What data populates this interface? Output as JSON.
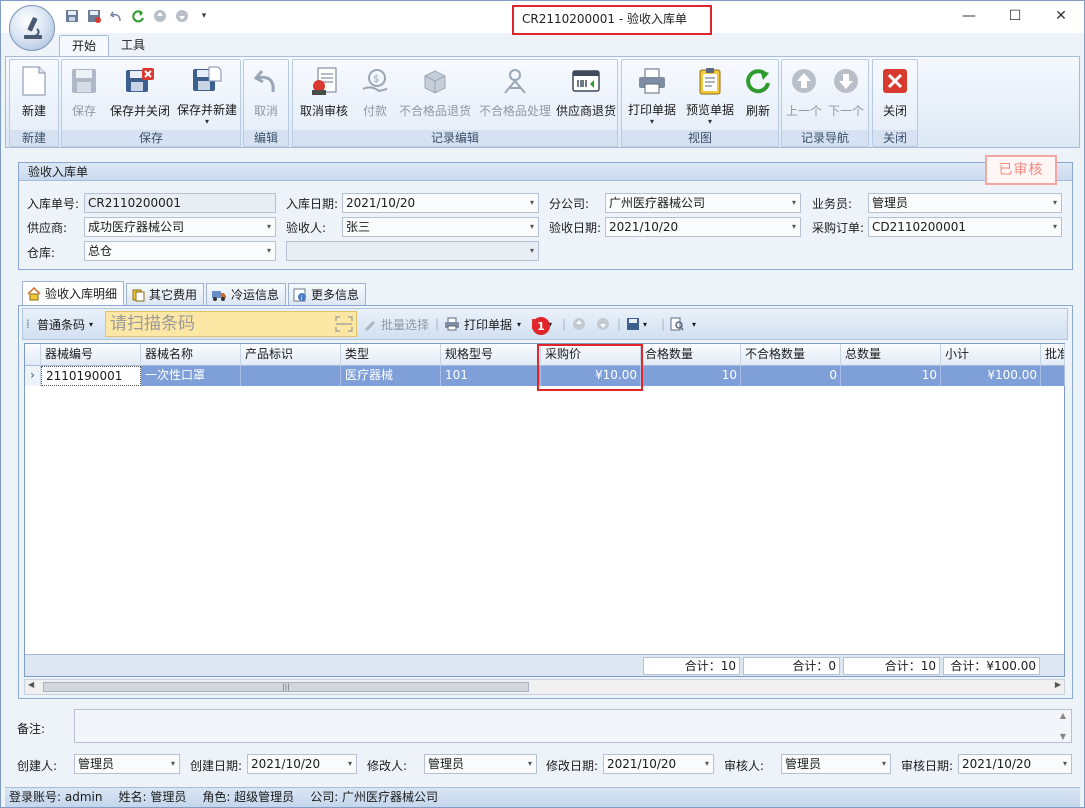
{
  "window": {
    "title": "CR2110200001 - 验收入库单"
  },
  "ribbon": {
    "tabs": [
      "开始",
      "工具"
    ],
    "groups": {
      "new": {
        "label": "新建",
        "buttons": [
          "新建"
        ]
      },
      "save": {
        "label": "保存",
        "buttons": [
          "保存",
          "保存并关闭",
          "保存并新建"
        ]
      },
      "edit": {
        "label": "编辑",
        "buttons": [
          "取消"
        ]
      },
      "record": {
        "label": "记录编辑",
        "buttons": [
          "取消审核",
          "付款",
          "不合格品退货",
          "不合格品处理",
          "供应商退货"
        ]
      },
      "view": {
        "label": "视图",
        "buttons": [
          "打印单据",
          "预览单据",
          "刷新"
        ]
      },
      "nav": {
        "label": "记录导航",
        "buttons": [
          "上一个",
          "下一个"
        ]
      },
      "close": {
        "label": "关闭",
        "buttons": [
          "关闭"
        ]
      }
    }
  },
  "header": {
    "panel_title": "验收入库单",
    "status_stamp": "已审核",
    "fields": {
      "receipt_no": {
        "label": "入库单号:",
        "value": "CR2110200001"
      },
      "receipt_date": {
        "label": "入库日期:",
        "value": "2021/10/20"
      },
      "branch": {
        "label": "分公司:",
        "value": "广州医疗器械公司"
      },
      "salesman": {
        "label": "业务员:",
        "value": "管理员"
      },
      "supplier": {
        "label": "供应商:",
        "value": "成功医疗器械公司"
      },
      "inspector": {
        "label": "验收人:",
        "value": "张三"
      },
      "inspect_date": {
        "label": "验收日期:",
        "value": "2021/10/20"
      },
      "po_no": {
        "label": "采购订单:",
        "value": "CD2110200001"
      },
      "warehouse": {
        "label": "仓库:",
        "value": "总仓"
      }
    }
  },
  "detail_tabs": [
    "验收入库明细",
    "其它费用",
    "冷运信息",
    "更多信息"
  ],
  "detail_toolbar": {
    "barcode_mode": "普通条码",
    "scan_placeholder": "请扫描条码",
    "batch_select": "批量选择",
    "print": "打印单据",
    "badge": "1"
  },
  "grid": {
    "columns": [
      "器械编号",
      "器械名称",
      "产品标识",
      "类型",
      "规格型号",
      "采购价",
      "合格数量",
      "不合格数量",
      "总数量",
      "小计",
      "批准"
    ],
    "rows": [
      {
        "code": "2110190001",
        "name": "一次性口罩",
        "udi": "",
        "type": "医疗器械",
        "spec": "101",
        "price": "¥10.00",
        "qualified": "10",
        "unqualified": "0",
        "total": "10",
        "subtotal": "¥100.00"
      }
    ],
    "totals": {
      "qualified": "合计：10",
      "unqualified": "合计：0",
      "total": "合计：10",
      "subtotal": "合计：¥100.00"
    }
  },
  "footer": {
    "remark_label": "备注:",
    "creator": {
      "label": "创建人:",
      "value": "管理员"
    },
    "create_date": {
      "label": "创建日期:",
      "value": "2021/10/20"
    },
    "modifier": {
      "label": "修改人:",
      "value": "管理员"
    },
    "modify_date": {
      "label": "修改日期:",
      "value": "2021/10/20"
    },
    "auditor": {
      "label": "审核人:",
      "value": "管理员"
    },
    "audit_date": {
      "label": "审核日期:",
      "value": "2021/10/20"
    }
  },
  "status_bar": {
    "account": "登录账号: admin",
    "name": "姓名: 管理员",
    "role": "角色: 超级管理员",
    "company": "公司: 广州医疗器械公司"
  },
  "colors": {
    "accent_red": "#e0262a",
    "selected_row": "#7f9fd9",
    "scan_input_bg": "#fde7a5",
    "stamp": "#f18a80"
  }
}
